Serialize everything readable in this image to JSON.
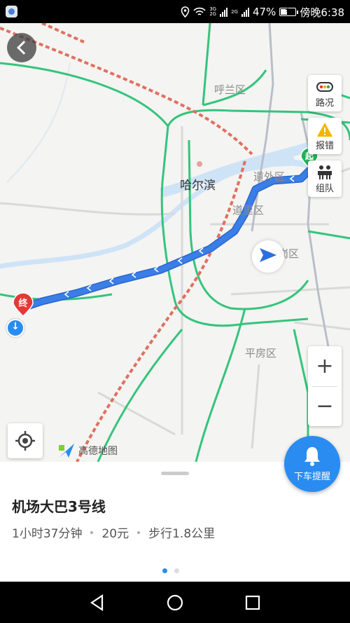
{
  "status_bar": {
    "net_top": "3G",
    "net_bottom": "2G",
    "net2": "2G",
    "battery_percent_text": "47%",
    "battery_level": 0.47,
    "time": "傍晚6:38"
  },
  "map": {
    "labels": {
      "hulan": "呼兰区",
      "harbin": "哈尔滨",
      "daowai": "道外区",
      "daoli": "道里区",
      "nangang": "南岗区",
      "pingfang": "平房区"
    },
    "start_marker": "起",
    "end_marker": "终",
    "logo_text": "高德地图",
    "tools": {
      "traffic": "路况",
      "report": "报错",
      "team": "组队"
    },
    "zoom_in": "+",
    "zoom_out": "−",
    "remind_label": "下车提醒",
    "colors": {
      "route": "#3a7ee8",
      "ring_road": "#34c47c",
      "railway": "#e07060",
      "water": "#cfe3f7",
      "accent": "#2a8cf0"
    }
  },
  "panel": {
    "route_name": "机场大巴3号线",
    "duration": "1小时37分钟",
    "fare": "20元",
    "walk": "步行1.8公里",
    "page_count": 2,
    "current_page": 1
  }
}
